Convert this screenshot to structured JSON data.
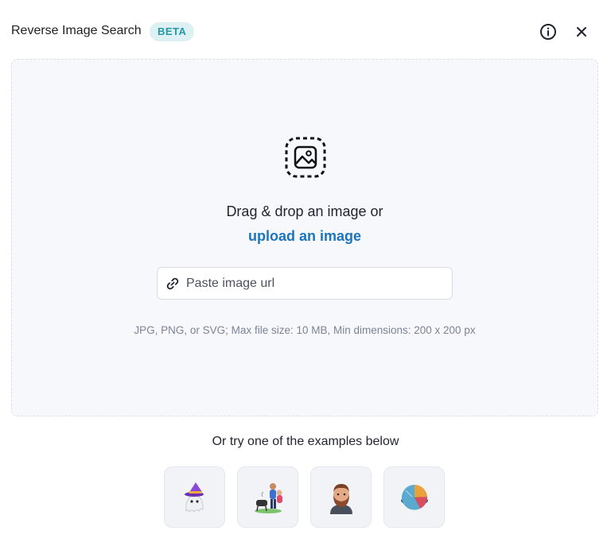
{
  "header": {
    "title": "Reverse Image Search",
    "badge": "BETA",
    "icons": {
      "info": "info-icon",
      "close": "close-icon"
    }
  },
  "dropzone": {
    "upload_icon": "image-upload-icon",
    "drag_text": "Drag & drop an image or",
    "upload_link": "upload an image",
    "url_input": {
      "placeholder": "Paste image url",
      "value": "",
      "icon": "link-icon"
    },
    "hint": "JPG, PNG, or SVG; Max file size: 10 MB, Min dimensions: 200 x 200 px"
  },
  "examples": {
    "title": "Or try one of the examples below",
    "items": [
      {
        "icon": "ghost-witch-icon"
      },
      {
        "icon": "people-grill-icon"
      },
      {
        "icon": "bearded-man-avatar-icon"
      },
      {
        "icon": "pie-chart-icon"
      }
    ]
  },
  "colors": {
    "accent": "#1b75bc",
    "badge_bg": "#ddf1f4",
    "badge_text": "#2697a8",
    "dropzone_bg": "#f7f8fb",
    "hint_text": "#7c8396"
  }
}
